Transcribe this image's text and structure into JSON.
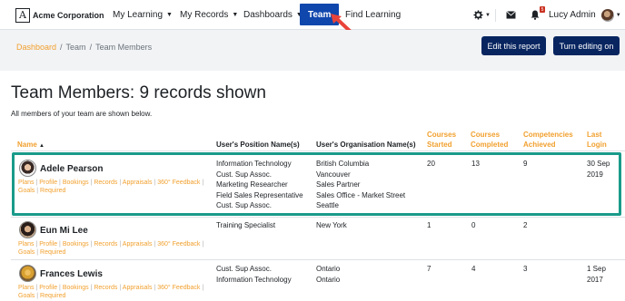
{
  "navbar": {
    "brand": "Acme Corporation",
    "items": [
      {
        "label": "My Learning"
      },
      {
        "label": "My Records"
      },
      {
        "label": "Dashboards"
      },
      {
        "label": "Team"
      },
      {
        "label": "Find Learning"
      }
    ],
    "notification_count": "5",
    "user_name": "Lucy Admin"
  },
  "breadcrumb": [
    "Dashboard",
    "Team",
    "Team Members"
  ],
  "actions": {
    "edit_report": "Edit this report",
    "turn_editing": "Turn editing on"
  },
  "page": {
    "title": "Team Members: 9 records shown",
    "subtitle": "All members of your team are shown below."
  },
  "table": {
    "headers": {
      "name": "Name",
      "position": "User's Position Name(s)",
      "organisation": "User's Organisation Name(s)",
      "courses_started_1": "Courses",
      "courses_started_2": "Started",
      "courses_completed_1": "Courses",
      "courses_completed_2": "Completed",
      "competencies_1": "Competencies",
      "competencies_2": "Achieved",
      "last_login_1": "Last",
      "last_login_2": "Login"
    },
    "links": {
      "plans": "Plans",
      "profile": "Profile",
      "bookings": "Bookings",
      "records": "Records",
      "appraisals": "Appraisals",
      "feedback": "360° Feedback",
      "goals": "Goals",
      "required": "Required"
    },
    "rows": [
      {
        "name": "Adele Pearson",
        "positions": [
          "Information Technology",
          "Cust. Sup Assoc.",
          "Marketing Researcher",
          "Field Sales Representative",
          "Cust. Sup Assoc."
        ],
        "organisations": [
          "British Columbia",
          "Vancouver",
          "Sales Partner",
          "Sales Office - Market Street",
          "Seattle"
        ],
        "courses_started": "20",
        "courses_completed": "13",
        "competencies": "9",
        "last_login_1": "30 Sep",
        "last_login_2": "2019"
      },
      {
        "name": "Eun Mi Lee",
        "positions": [
          "Training Specialist"
        ],
        "organisations": [
          "New York"
        ],
        "courses_started": "1",
        "courses_completed": "0",
        "competencies": "2",
        "last_login_1": "",
        "last_login_2": ""
      },
      {
        "name": "Frances Lewis",
        "positions": [
          "Cust. Sup Assoc.",
          "Information Technology"
        ],
        "organisations": [
          "Ontario",
          "Ontario"
        ],
        "courses_started": "7",
        "courses_completed": "4",
        "competencies": "3",
        "last_login_1": "1 Sep",
        "last_login_2": "2017"
      }
    ]
  },
  "colors": {
    "brand_navy": "#082560",
    "active_nav": "#0f47ad",
    "link_orange": "#f1a02e",
    "highlight_teal": "#1a9b8a",
    "badge_red": "#ca3120"
  }
}
